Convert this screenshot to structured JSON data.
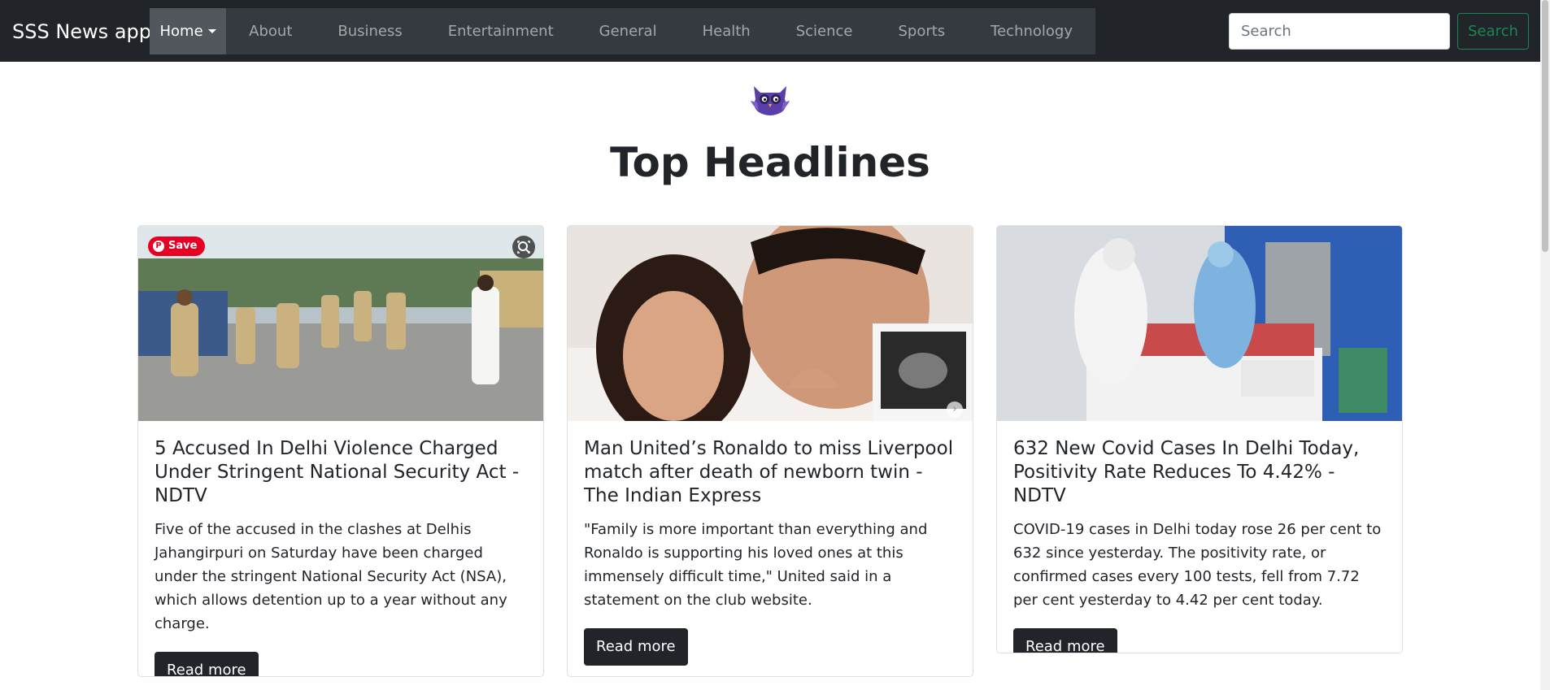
{
  "navbar": {
    "brand": "SSS News app",
    "items": [
      {
        "label": "Home"
      },
      {
        "label": "About"
      },
      {
        "label": "Business"
      },
      {
        "label": "Entertainment"
      },
      {
        "label": "General"
      },
      {
        "label": "Health"
      },
      {
        "label": "Science"
      },
      {
        "label": "Sports"
      },
      {
        "label": "Technology"
      }
    ],
    "search": {
      "placeholder": "Search",
      "value": "",
      "button_label": "Search"
    }
  },
  "header": {
    "logo_icon": "owl-logo-icon",
    "title": "Top Headlines"
  },
  "articles": [
    {
      "title": "5 Accused In Delhi Violence Charged Under Stringent National Security Act - NDTV",
      "description": "Five of the accused in the clashes at Delhis Jahangirpuri on Saturday have been charged under the stringent National Security Act (NSA), which allows detention up to a year without any charge.",
      "button_label": "Read more",
      "pin_save_label": "Save"
    },
    {
      "title": "Man United’s Ronaldo to miss Liverpool match after death of newborn twin - The Indian Express",
      "description": "\"Family is more important than everything and Ronaldo is supporting his loved ones at this immensely difficult time,\" United said in a statement on the club website.",
      "button_label": "Read more"
    },
    {
      "title": "632 New Covid Cases In Delhi Today, Positivity Rate Reduces To 4.42% - NDTV",
      "description": "COVID-19 cases in Delhi today rose 26 per cent to 632 since yesterday. The positivity rate, or confirmed cases every 100 tests, fell from 7.72 per cent yesterday to 4.42 per cent today.",
      "button_label": "Read more"
    }
  ],
  "colors": {
    "navbar_bg": "#212529",
    "nav_group_bg": "#343a40",
    "nav_active_bg": "#51575d",
    "search_button": "#198754",
    "button_dark": "#212529",
    "pinterest_red": "#e60023",
    "logo_purple": "#5b3fa8"
  }
}
